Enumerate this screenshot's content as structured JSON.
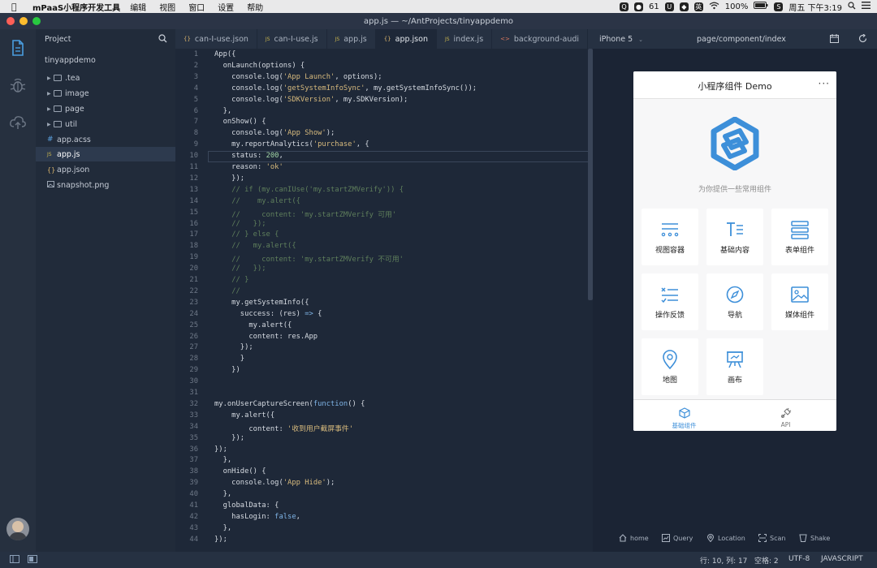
{
  "menubar": {
    "app_name": "mPaaS小程序开发工具",
    "menus": [
      "编辑",
      "视图",
      "窗口",
      "设置",
      "帮助"
    ],
    "tray_count": "61",
    "battery": "100%",
    "clock": "周五 下午3:19"
  },
  "window": {
    "title": "app.js — ~/AntProjects/tinyappdemo"
  },
  "explorer": {
    "header": "Project",
    "root": "tinyappdemo",
    "items": [
      {
        "label": ".tea",
        "type": "folder"
      },
      {
        "label": "image",
        "type": "folder"
      },
      {
        "label": "page",
        "type": "folder"
      },
      {
        "label": "util",
        "type": "folder"
      },
      {
        "label": "app.acss",
        "type": "file",
        "icon": "#"
      },
      {
        "label": "app.js",
        "type": "file",
        "icon": "JS"
      },
      {
        "label": "app.json",
        "type": "file",
        "icon": "{}"
      },
      {
        "label": "snapshot.png",
        "type": "file",
        "icon": "img"
      }
    ]
  },
  "editor": {
    "tabs": [
      {
        "label": "can-I-use.json",
        "icon": "{}"
      },
      {
        "label": "can-I-use.js",
        "icon": "JS"
      },
      {
        "label": "app.js",
        "icon": "JS"
      },
      {
        "label": "app.json",
        "icon": "{}"
      },
      {
        "label": "index.js",
        "icon": "JS"
      },
      {
        "label": "background-audi",
        "icon": "<>"
      }
    ],
    "active_tab": 2,
    "current_line": 10,
    "lines": [
      "App({",
      "  onLaunch(options) {",
      "    console.log('App Launch', options);",
      "    console.log('getSystemInfoSync', my.getSystemInfoSync());",
      "    console.log('SDKVersion', my.SDKVersion);",
      "  },",
      "  onShow() {",
      "    console.log('App Show');",
      "    my.reportAnalytics('purchase', {",
      "    status: 200,",
      "    reason: 'ok'",
      "    });",
      "    // if (my.canIUse('my.startZMVerify')) {",
      "    //    my.alert({",
      "    //     content: 'my.startZMVerify 可用'",
      "    //   });",
      "    // } else {",
      "    //   my.alert({",
      "    //     content: 'my.startZMVerify 不可用'",
      "    //   });",
      "    // }",
      "    //",
      "    my.getSystemInfo({",
      "      success: (res) => {",
      "        my.alert({",
      "        content: res.App",
      "      });",
      "      }",
      "    })",
      "",
      "",
      "my.onUserCaptureScreen(function() {",
      "    my.alert({",
      "        content: '收到用户截屏事件'",
      "    });",
      "});",
      "  },",
      "  onHide() {",
      "    console.log('App Hide');",
      "  },",
      "  globalData: {",
      "    hasLogin: false,",
      "  },",
      "});"
    ]
  },
  "simulator": {
    "device": "iPhone 5",
    "path": "page/component/index",
    "page_title": "小程序组件 Demo",
    "more": "···",
    "subtitle": "为你提供一些常用组件",
    "cards": [
      {
        "label": "视图容器",
        "icon": "list-icon"
      },
      {
        "label": "基础内容",
        "icon": "text-icon"
      },
      {
        "label": "表单组件",
        "icon": "form-icon"
      },
      {
        "label": "操作反馈",
        "icon": "feedback-icon"
      },
      {
        "label": "导航",
        "icon": "compass-icon"
      },
      {
        "label": "媒体组件",
        "icon": "image-icon"
      },
      {
        "label": "地图",
        "icon": "map-pin-icon"
      },
      {
        "label": "画布",
        "icon": "canvas-icon"
      }
    ],
    "tabbar": [
      {
        "label": "基础组件",
        "active": true
      },
      {
        "label": "API",
        "active": false
      }
    ],
    "tools": [
      "home",
      "Query",
      "Location",
      "Scan",
      "Shake"
    ]
  },
  "statusbar": {
    "position": "行: 10, 列: 17",
    "indent": "空格: 2",
    "encoding": "UTF-8",
    "language": "JAVASCRIPT"
  },
  "colors": {
    "accent_blue": "#3d8fd9",
    "tab_inactive": "#777777"
  }
}
